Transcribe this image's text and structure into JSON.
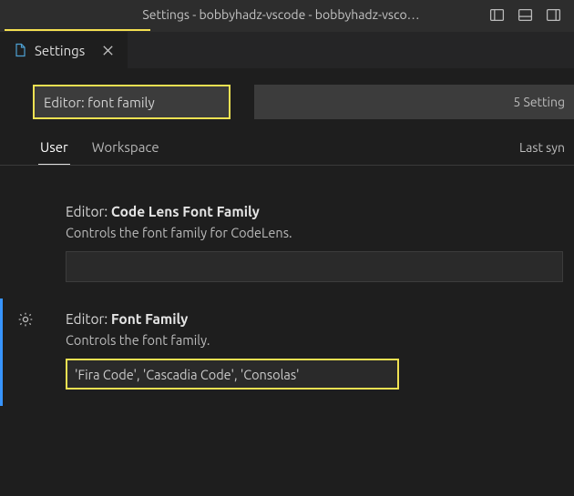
{
  "window": {
    "title": "Settings - bobbyhadz-vscode - bobbyhadz-vsco…"
  },
  "tab": {
    "label": "Settings"
  },
  "search": {
    "value": "Editor: font family",
    "result_count": "5 Setting"
  },
  "scope": {
    "user": "User",
    "workspace": "Workspace",
    "sync": "Last syn"
  },
  "settings": [
    {
      "prefix": "Editor:",
      "name": "Code Lens Font Family",
      "description": "Controls the font family for CodeLens.",
      "value": ""
    },
    {
      "prefix": "Editor:",
      "name": "Font Family",
      "description": "Controls the font family.",
      "value": "'Fira Code', 'Cascadia Code', 'Consolas'"
    }
  ]
}
